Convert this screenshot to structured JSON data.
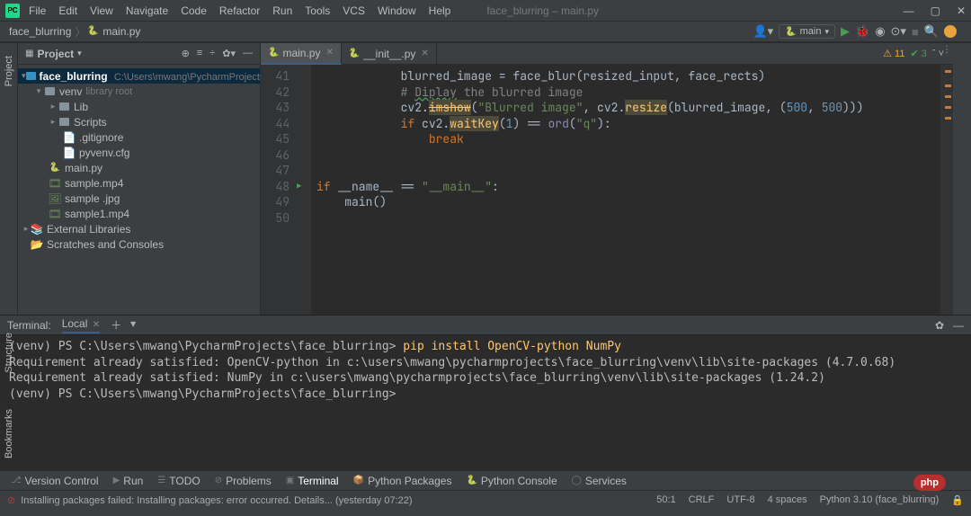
{
  "menubar": {
    "items": [
      "File",
      "Edit",
      "View",
      "Navigate",
      "Code",
      "Refactor",
      "Run",
      "Tools",
      "VCS",
      "Window",
      "Help"
    ],
    "title": "face_blurring – main.py"
  },
  "breadcrumb": {
    "items": [
      "face_blurring",
      "main.py"
    ]
  },
  "run_config": {
    "name": "main"
  },
  "project": {
    "panel_label": "Project",
    "side_label": "Project",
    "root_name": "face_blurring",
    "root_path": "C:\\Users\\mwang\\PycharmProjects\\face_b",
    "venv": {
      "name": "venv",
      "hint": "library root",
      "children": [
        "Lib",
        "Scripts",
        ".gitignore",
        "pyvenv.cfg"
      ]
    },
    "files": [
      "main.py",
      "sample.mp4",
      "sample .jpg",
      "sample1.mp4"
    ],
    "ext_lib": "External Libraries",
    "scratches": "Scratches and Consoles"
  },
  "tabs": {
    "t0": "main.py",
    "t1": "__init__.py",
    "warn": "11",
    "ok": "3"
  },
  "code": {
    "lines": [
      "41",
      "42",
      "43",
      "44",
      "45",
      "46",
      "47",
      "48",
      "49",
      "50"
    ],
    "l41a": "blurred_image = face_blur(resized_input, face_rects)",
    "l42a": "# ",
    "l42b": "Diplay",
    "l42c": " the blurred image",
    "l43a": "cv2.",
    "l43b": "imshow",
    "l43c": "(",
    "l43d": "\"Blurred image\"",
    "l43e": ", cv2.",
    "l43f": "resize",
    "l43g": "(blurred_image, (",
    "l43h": "500",
    "l43i": ", ",
    "l43j": "500",
    "l43k": ")))",
    "l44a": "if ",
    "l44b": "cv2.",
    "l44c": "waitKey",
    "l44d": "(",
    "l44e": "1",
    "l44f": ") == ",
    "l44g": "ord",
    "l44h": "(",
    "l44i": "\"q\"",
    "l44j": "):",
    "l45a": "break",
    "l48a": "if ",
    "l48b": "__name__ == ",
    "l48c": "\"__main__\"",
    "l48d": ":",
    "l49a": "main()"
  },
  "terminal": {
    "title": "Terminal:",
    "tab": "Local",
    "l1a": "(venv) PS C:\\Users\\mwang\\PycharmProjects\\face_blurring> ",
    "l1b": "pip install OpenCV-python NumPy",
    "l2": "Requirement already satisfied: OpenCV-python in c:\\users\\mwang\\pycharmprojects\\face_blurring\\venv\\lib\\site-packages (4.7.0.68)",
    "l3": "Requirement already satisfied: NumPy in c:\\users\\mwang\\pycharmprojects\\face_blurring\\venv\\lib\\site-packages (1.24.2)",
    "l4": "(venv) PS C:\\Users\\mwang\\PycharmProjects\\face_blurring>"
  },
  "bottom_tools": {
    "vc": "Version Control",
    "run": "Run",
    "todo": "TODO",
    "problems": "Problems",
    "terminal": "Terminal",
    "pypkg": "Python Packages",
    "pycon": "Python Console",
    "services": "Services"
  },
  "status": {
    "msg": "Installing packages failed: Installing packages: error occurred. Details... (yesterday 07:22)",
    "pos": "50:1",
    "crlf": "CRLF",
    "enc": "UTF-8",
    "indent": "4 spaces",
    "interp": "Python 3.10 (face_blurring)"
  },
  "side_labels": {
    "structure": "Structure",
    "bookmarks": "Bookmarks"
  },
  "brand": "php"
}
